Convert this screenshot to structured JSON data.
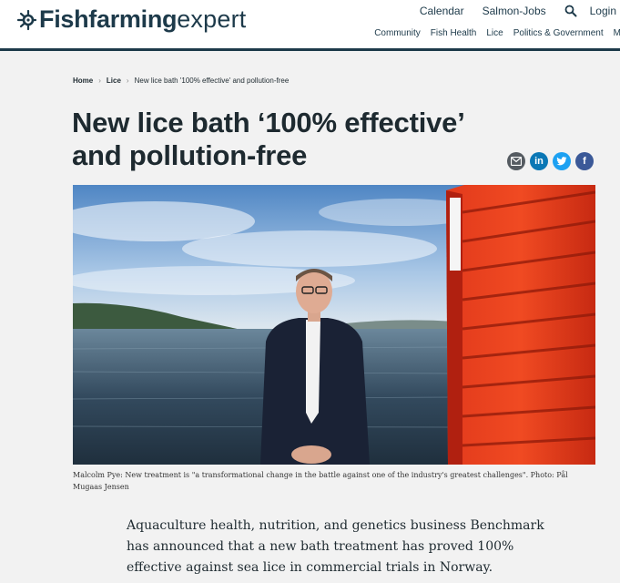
{
  "header": {
    "logo_bold": "Fishfarming",
    "logo_light": "expert",
    "top_links": [
      "Calendar",
      "Salmon-Jobs"
    ],
    "login_label": "Login",
    "nav_items": [
      "Community",
      "Fish Health",
      "Lice",
      "Politics & Government",
      "M"
    ]
  },
  "breadcrumb": {
    "home": "Home",
    "section": "Lice",
    "current": "New lice bath '100% effective' and pollution-free"
  },
  "article": {
    "title": "New lice bath ‘100% effective’ and pollution-free",
    "caption": "Malcolm Pye: New treatment is \"a transformational change in the battle against one of the industry's greatest challenges\". Photo: Pål Mugaas Jensen",
    "lead": "Aquaculture health, nutrition, and genetics business Benchmark has announced that a new bath treatment has proved 100% effective against sea lice in commercial trials in Norway."
  },
  "share": {
    "email_icon": "envelope-icon",
    "linkedin_glyph": "in",
    "twitter_icon": "bird-icon",
    "facebook_glyph": "f",
    "colors": {
      "email": "#555b61",
      "linkedin": "#0a77b5",
      "twitter": "#1da1f2",
      "facebook": "#3b5998"
    }
  },
  "colors": {
    "brand": "#1d3a4a",
    "background": "#f2f2f2"
  }
}
